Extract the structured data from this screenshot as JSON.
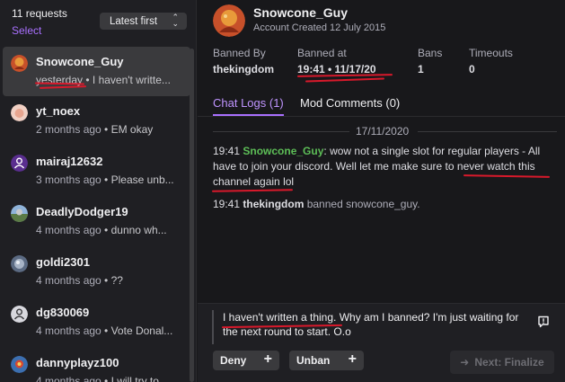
{
  "left_panel": {
    "request_count": "11 requests",
    "select_label": "Select",
    "sort_label": "Latest first"
  },
  "requests": [
    {
      "username": "Snowcone_Guy",
      "time": "yesterday",
      "preview": "I haven't writte...",
      "avatar_color": "#c7502a"
    },
    {
      "username": "yt_noex",
      "time": "2 months ago",
      "preview": "EM okay",
      "avatar_color": "#e8b7a6"
    },
    {
      "username": "mairaj12632",
      "time": "3 months ago",
      "preview": "Please unb...",
      "avatar_color": "#5a2e8f"
    },
    {
      "username": "DeadlyDodger19",
      "time": "4 months ago",
      "preview": "dunno wh...",
      "avatar_color": "#6a8f5a"
    },
    {
      "username": "goldi2301",
      "time": "4 months ago",
      "preview": "??",
      "avatar_color": "#6f7f9a"
    },
    {
      "username": "dg830069",
      "time": "4 months ago",
      "preview": "Vote Donal...",
      "avatar_color": "#d8d8de"
    },
    {
      "username": "dannyplayz100",
      "time": "4 months ago",
      "preview": "I will try to ...",
      "avatar_color": "#3c6fb0"
    }
  ],
  "profile": {
    "username": "Snowcone_Guy",
    "created": "Account Created 12 July 2015"
  },
  "stats": [
    {
      "label": "Banned By",
      "value": "thekingdom"
    },
    {
      "label": "Banned at",
      "value": "19:41 • 11/17/20"
    },
    {
      "label": "Bans",
      "value": "1"
    },
    {
      "label": "Timeouts",
      "value": "0"
    }
  ],
  "tabs": {
    "chat_logs": "Chat Logs (1)",
    "mod_comments": "Mod Comments (0)"
  },
  "chat": {
    "date": "17/11/2020",
    "msg1_time": "19:41",
    "msg1_user": "Snowcone_Guy",
    "msg1_text": ": wow not a single slot for regular players - All have to join your discord. Well let me make sure to never watch this channel again lol",
    "msg2_time": "19:41",
    "msg2_user": "thekingdom",
    "msg2_text": " banned snowcone_guy."
  },
  "footer": {
    "message": "I haven't written a thing. Why am I banned? I'm just waiting for the next round to start. O.o",
    "deny_label": "Deny",
    "unban_label": "Unban",
    "finalize_label": "Next: Finalize"
  },
  "colors": {
    "accent": "#a970ff",
    "username_green": "#5dbe57",
    "annotation_red": "#d8192b"
  }
}
